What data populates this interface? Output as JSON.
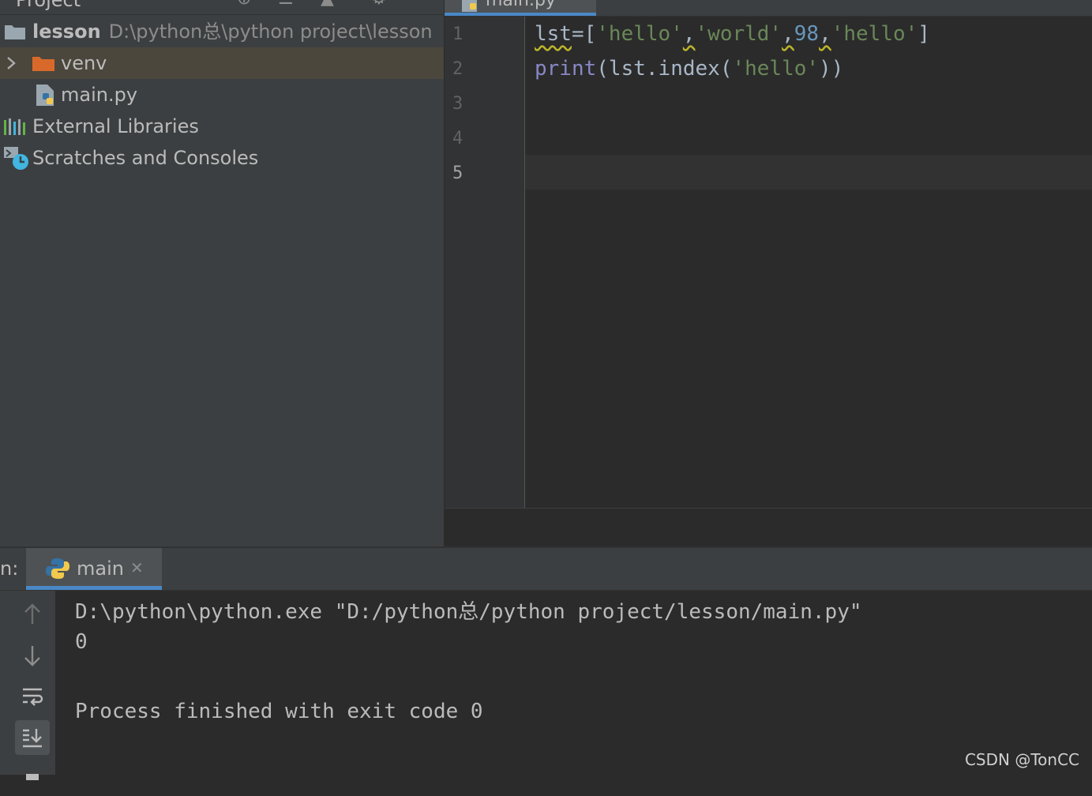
{
  "project": {
    "title": "Project",
    "root": {
      "name": "lesson",
      "path": "D:\\python总\\python project\\lesson"
    },
    "items": [
      {
        "label": "venv",
        "icon": "folder-icon",
        "color": "#d9692b"
      },
      {
        "label": "main.py",
        "icon": "python-file-icon"
      },
      {
        "label": "External Libraries",
        "icon": "libraries-icon"
      },
      {
        "label": "Scratches and Consoles",
        "icon": "scratches-icon"
      }
    ]
  },
  "editor": {
    "tab_label": "main.py",
    "line_numbers": [
      "1",
      "2",
      "3",
      "4",
      "5"
    ],
    "code": {
      "line1": {
        "a": "lst",
        "b": "=[",
        "c": "'hello'",
        "d": ",",
        "e": "'world'",
        "f": ",",
        "g": "98",
        "h": ",",
        "i": "'hello'",
        "j": "]"
      },
      "line2": {
        "a": "print",
        "b": "(lst.index(",
        "c": "'hello'",
        "d": "))"
      }
    },
    "colors": {
      "string": "#6a8759",
      "number": "#6897bb",
      "builtin": "#8888c6",
      "accent": "#4a88c7"
    }
  },
  "run": {
    "title": "n:",
    "tab_label": "main",
    "close_glyph": "✕",
    "console": [
      "D:\\python\\python.exe \"D:/python总/python project/lesson/main.py\"",
      "0",
      "",
      "Process finished with exit code 0"
    ],
    "toolbar": [
      "up-arrow-icon",
      "down-arrow-icon",
      "soft-wrap-icon",
      "scroll-to-end-icon",
      "print-icon"
    ]
  },
  "watermark": "CSDN @TonCC"
}
